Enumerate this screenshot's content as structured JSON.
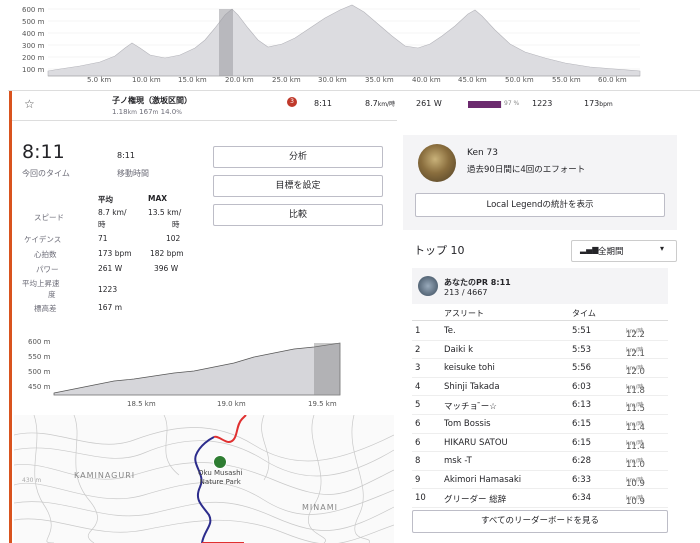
{
  "top_profile": {
    "y_ticks": [
      "600 m",
      "500 m",
      "400 m",
      "300 m",
      "200 m",
      "100 m"
    ],
    "x_ticks": [
      "5.0 km",
      "10.0 km",
      "15.0 km",
      "20.0 km",
      "25.0 km",
      "30.0 km",
      "35.0 km",
      "40.0 km",
      "45.0 km",
      "50.0 km",
      "55.0 km",
      "60.0 km"
    ]
  },
  "segment": {
    "star": "☆",
    "name": "子ノ権現（激坂区間）",
    "distance": "1.18",
    "distance_unit": "km",
    "elev_gain": "167",
    "elev_unit": "m",
    "grade": "14.0",
    "grade_unit": "%",
    "badge": "3",
    "time": "8:11",
    "speed": "8.7",
    "speed_unit": "km/時",
    "power": "261 W",
    "hr_pct": "97 %",
    "hr_fraction": 0.97,
    "cadence_val": "1223",
    "bpm": "173",
    "bpm_unit": "bpm"
  },
  "summary": {
    "time": "8:11",
    "time_label": "今回のタイム",
    "moving_time": "8:11",
    "moving_label": "移動時間",
    "col_avg": "平均",
    "col_max": "MAX",
    "rows": [
      {
        "label": "スピード",
        "avg": "8.7 km/",
        "avg2": "時",
        "max": "13.5 km/",
        "max2": "時"
      },
      {
        "label": "ケイデンス",
        "avg": "71",
        "max": "102"
      },
      {
        "label": "心拍数",
        "avg": "173 bpm",
        "max": "182 bpm"
      },
      {
        "label": "パワー",
        "avg": "261 W",
        "max": "396 W"
      },
      {
        "label": "平均上昇速",
        "label2": "度",
        "avg": "1223",
        "max": ""
      },
      {
        "label": "標高差",
        "avg": "167 m",
        "max": ""
      }
    ]
  },
  "buttons": {
    "analyze": "分析",
    "set_goal": "目標を設定",
    "compare": "比較"
  },
  "mini_profile": {
    "y_ticks": [
      "600 m",
      "550 m",
      "500 m",
      "450 m"
    ],
    "x_ticks": [
      "18.5 km",
      "19.0 km",
      "19.5 km"
    ]
  },
  "map": {
    "label_left": "KAMINAGURI",
    "label_right": "MINAMI",
    "park_line1": "Oku Musashi",
    "park_line2": "Nature Park",
    "contour_label": "430 m"
  },
  "local_legend": {
    "name": "Ken 73",
    "efforts": "過去90日間に4回のエフォート",
    "button": "Local Legendの統計を表示"
  },
  "top10": {
    "title": "トップ 10",
    "filter": "全期間",
    "your_pr_label": "あなたのPR 8:11",
    "your_rank": "213 / 4667",
    "col_athlete": "アスリート",
    "col_time": "タイム",
    "rows": [
      {
        "rank": "1",
        "name": "Te.",
        "time": "5:51",
        "speed": "12.2",
        "unit": "km/時"
      },
      {
        "rank": "2",
        "name": "Daiki k",
        "time": "5:53",
        "speed": "12.1",
        "unit": "km/時"
      },
      {
        "rank": "3",
        "name": "keisuke tohi",
        "time": "5:56",
        "speed": "12.0",
        "unit": "km/時"
      },
      {
        "rank": "4",
        "name": "Shinji Takada",
        "time": "6:03",
        "speed": "11.8",
        "unit": "km/時"
      },
      {
        "rank": "5",
        "name": "マッチョ ̄ー☆",
        "time": "6:13",
        "speed": "11.5",
        "unit": "km/時"
      },
      {
        "rank": "6",
        "name": "Tom Bossis",
        "time": "6:15",
        "speed": "11.4",
        "unit": "km/時"
      },
      {
        "rank": "6",
        "name": "HIKARU SATOU",
        "time": "6:15",
        "speed": "11.4",
        "unit": "km/時"
      },
      {
        "rank": "8",
        "name": "msk -T",
        "time": "6:28",
        "speed": "11.0",
        "unit": "km/時"
      },
      {
        "rank": "9",
        "name": "Akimori Hamasaki",
        "time": "6:33",
        "speed": "10.9",
        "unit": "km/時"
      },
      {
        "rank": "10",
        "name": "グリーダー 総辞",
        "time": "6:34",
        "speed": "10.9",
        "unit": "km/時"
      }
    ],
    "all_button": "すべてのリーダーボードを見る"
  },
  "colors": {
    "accent": "#d9531e",
    "bar": "#6b2a6e",
    "profile_fill": "#d8d8dc",
    "route": "#2c2c8c",
    "route_seg": "#e03030"
  }
}
